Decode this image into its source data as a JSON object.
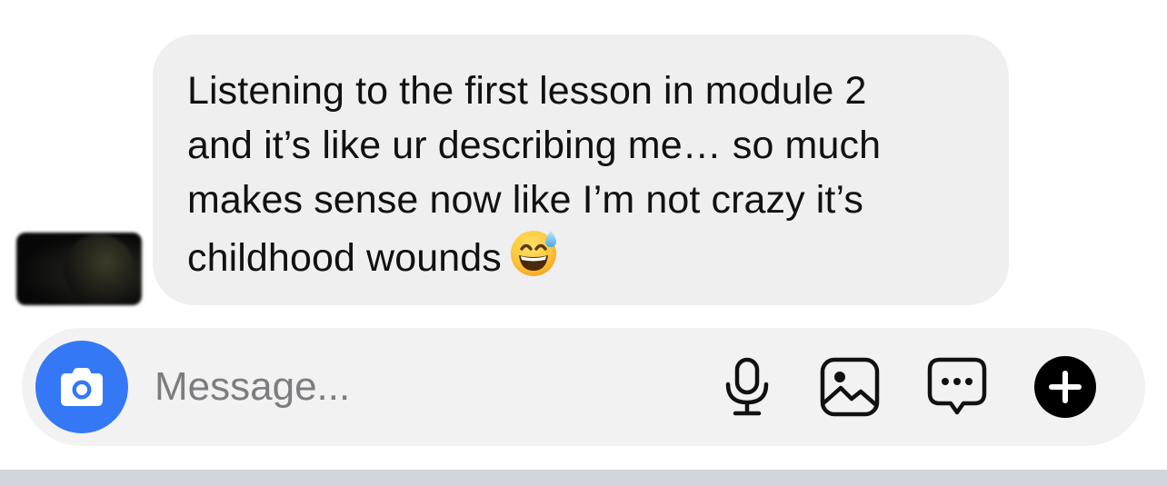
{
  "conversation": {
    "messages": [
      {
        "sender": "other",
        "text": "Listening to the first lesson in module 2\nand it’s like ur describing me… so much\nmakes sense now like I’m not crazy it’s\nchildhood wounds",
        "emoji": "sweat-smile-emoji"
      }
    ]
  },
  "composer": {
    "placeholder": "Message...",
    "value": "",
    "camera_icon": "camera-icon",
    "mic_icon": "microphone-icon",
    "gallery_icon": "image-icon",
    "sticker_icon": "chat-bubble-icon",
    "add_icon": "plus-icon"
  },
  "colors": {
    "bubble_background": "#efeff0",
    "composer_background": "#f2f2f3",
    "camera_accent": "#3478f6",
    "placeholder_text": "#7d7d80",
    "bottom_bar": "#d2d5db"
  }
}
